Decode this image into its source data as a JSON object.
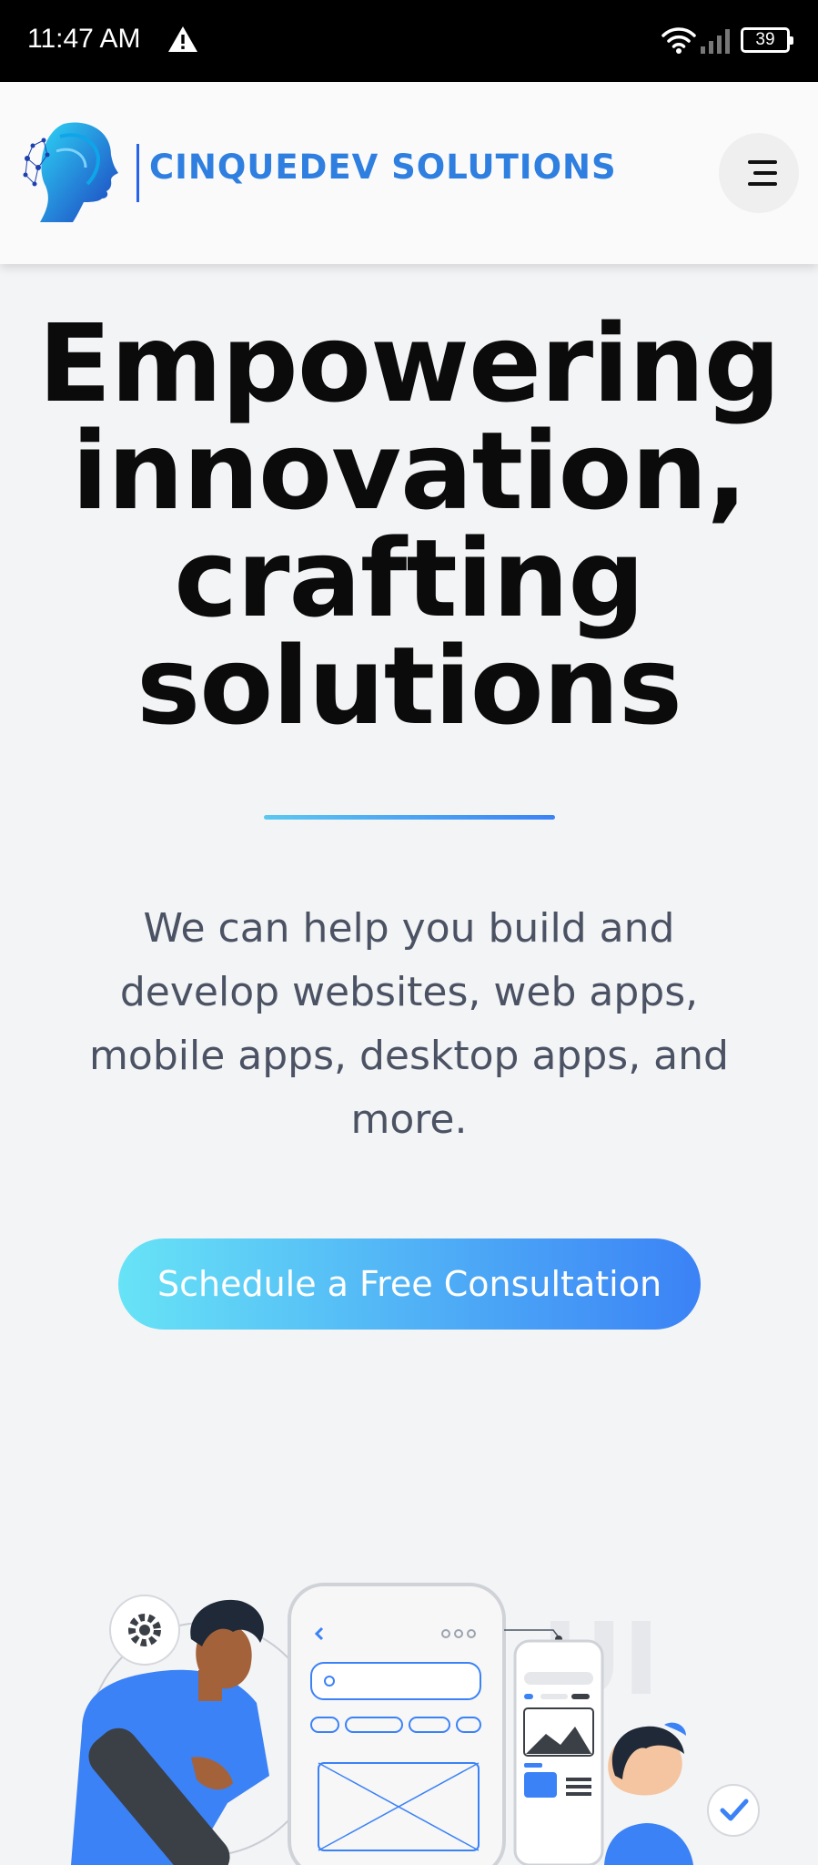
{
  "status_bar": {
    "time": "11:47 AM",
    "battery": "39"
  },
  "header": {
    "brand": "CINQUEDEV  SOLUTIONS",
    "menu_icon": "hamburger-menu-icon"
  },
  "hero": {
    "title_lines": [
      "Empowering",
      "innovation,",
      "crafting",
      "solutions"
    ],
    "subtitle_lines": [
      "We can help you build and",
      "develop websites, web apps,",
      "mobile apps, desktop apps, and",
      "more."
    ],
    "cta_label": "Schedule a Free Consultation"
  },
  "illustration": {
    "watermark": "UI"
  },
  "colors": {
    "brand_blue": "#2f7fe0",
    "cta_gradient_start": "#67e3f6",
    "cta_gradient_end": "#3b82f6",
    "title": "#0b0b0b",
    "subtitle": "#4b5263",
    "background": "#f3f4f6"
  }
}
